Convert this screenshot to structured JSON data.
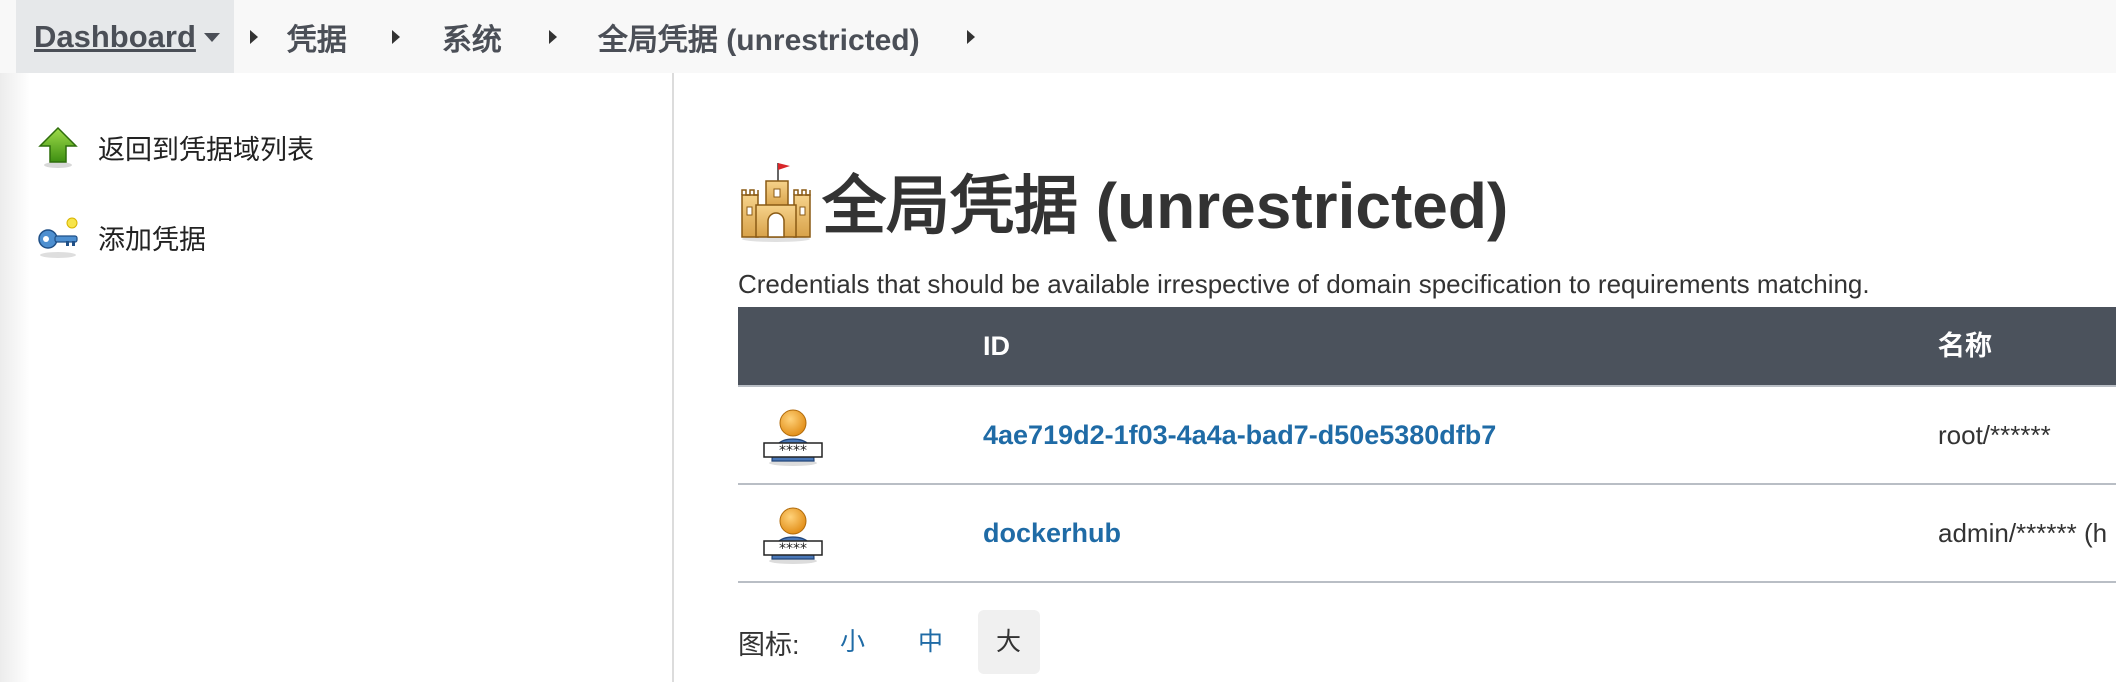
{
  "breadcrumb": {
    "dashboard": "Dashboard",
    "items": [
      "凭据",
      "系统",
      "全局凭据 (unrestricted)"
    ]
  },
  "sidebar": {
    "tasks": [
      {
        "label": "返回到凭据域列表",
        "icon": "up-arrow-icon"
      },
      {
        "label": "添加凭据",
        "icon": "key-icon"
      }
    ]
  },
  "main": {
    "title": "全局凭据 (unrestricted)",
    "title_icon": "castle-icon",
    "description": "Credentials that should be available irrespective of domain specification to requirements matching.",
    "table": {
      "headers": {
        "id": "ID",
        "name": "名称"
      },
      "rows": [
        {
          "id": "4ae719d2-1f03-4a4a-bad7-d50e5380dfb7",
          "name": "root/******"
        },
        {
          "id": "dockerhub",
          "name": "admin/****** (h"
        }
      ]
    },
    "icon_size": {
      "label": "图标:",
      "options": [
        "小",
        "中",
        "大"
      ],
      "selected": "大"
    }
  },
  "colors": {
    "table_header_bg": "#4b525c",
    "link": "#1f6ba6",
    "topbar_bg": "#f8f8f8"
  }
}
